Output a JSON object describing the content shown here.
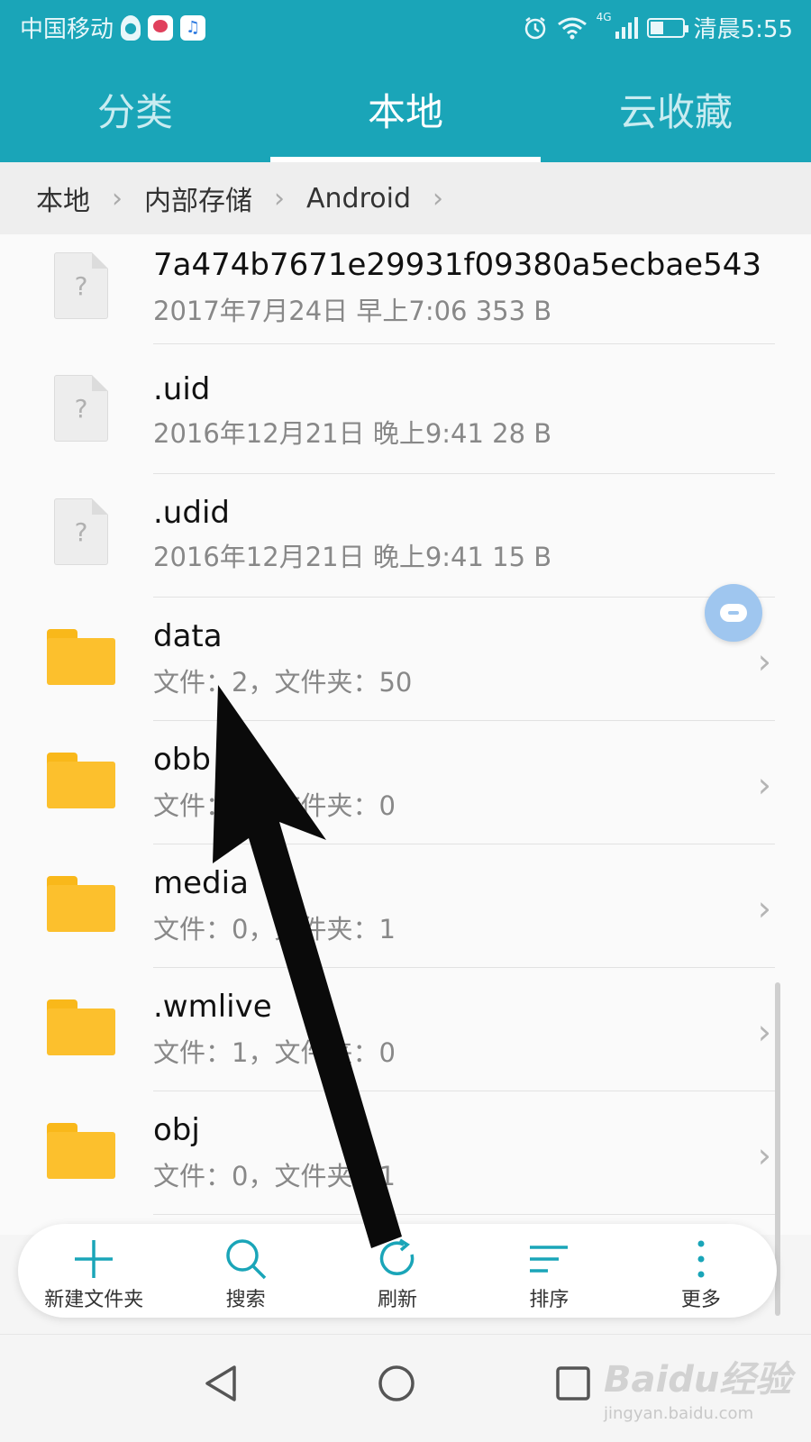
{
  "status_bar": {
    "carrier": "中国移动",
    "network": "4G",
    "time": "清晨5:55"
  },
  "tabs": [
    {
      "label": "分类",
      "active": false
    },
    {
      "label": "本地",
      "active": true
    },
    {
      "label": "云收藏",
      "active": false
    }
  ],
  "breadcrumb": [
    "本地",
    "内部存储",
    "Android"
  ],
  "files": [
    {
      "type": "file",
      "name": "7a474b7671e29931f09380a5ecbae543",
      "meta": "2017年7月24日 早上7:06 353 B"
    },
    {
      "type": "file",
      "name": ".uid",
      "meta": "2016年12月21日 晚上9:41 28 B"
    },
    {
      "type": "file",
      "name": ".udid",
      "meta": "2016年12月21日 晚上9:41 15 B"
    },
    {
      "type": "folder",
      "name": "data",
      "meta": "文件：2，文件夹：50"
    },
    {
      "type": "folder",
      "name": "obb",
      "meta": "文件：0，文件夹：0"
    },
    {
      "type": "folder",
      "name": "media",
      "meta": "文件：0，文件夹：1"
    },
    {
      "type": "folder",
      "name": ".wmlive",
      "meta": "文件：1，文件夹：0"
    },
    {
      "type": "folder",
      "name": "obj",
      "meta": "文件：0，文件夹：1"
    }
  ],
  "toolbar": {
    "new_folder": "新建文件夹",
    "search": "搜索",
    "refresh": "刷新",
    "sort": "排序",
    "more": "更多"
  },
  "watermark": {
    "logo": "Baidu经验",
    "url": "jingyan.baidu.com"
  },
  "colors": {
    "accent": "#1aa5b8",
    "folder": "#fcc02d",
    "icon_teal": "#1aa5b8"
  }
}
